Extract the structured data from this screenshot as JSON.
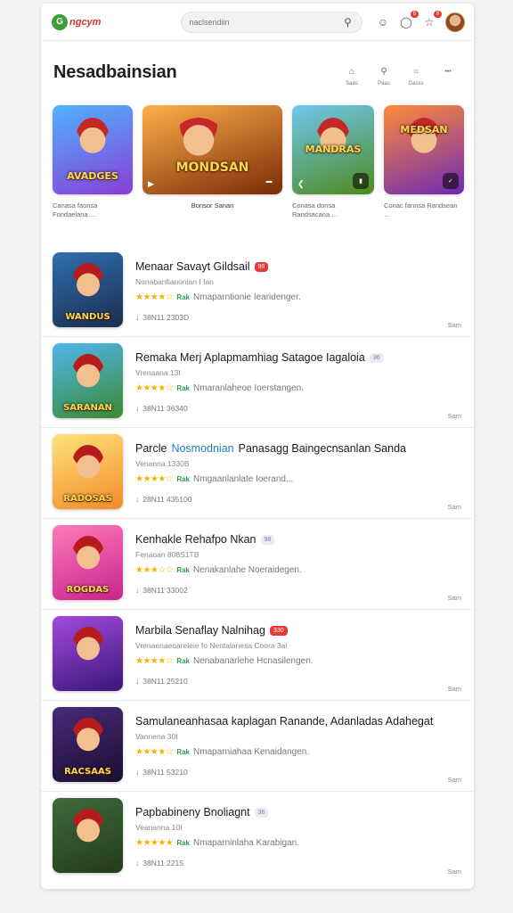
{
  "topbar": {
    "logo_mark": "G",
    "logo_text": "ngcym",
    "search_placeholder": "naclsendiin",
    "badge_1": "8",
    "badge_2": "8"
  },
  "header": {
    "title": "Nesadbainsian",
    "actions": [
      "Saas",
      "Paas",
      "Gasss"
    ],
    "more_label": "•••"
  },
  "featured": [
    {
      "name": "AVADGES",
      "caption": "Canasa faonsa Fondaelana  …",
      "colors": [
        "#4fb3ff",
        "#8a3dd6"
      ]
    },
    {
      "name": "MONDSAN",
      "caption": "Bonsor Sanan",
      "colors": [
        "#ffb04a",
        "#7a2a06"
      ]
    },
    {
      "name": "MANDRAS",
      "caption": "Conasa donsa Randsacana …",
      "colors": [
        "#6fc7ef",
        "#4f8a1f"
      ]
    },
    {
      "name": "MEDSAN",
      "caption": "Conac fannsa Randsean  …",
      "colors": [
        "#ff8a3a",
        "#6d2ab3"
      ]
    }
  ],
  "apps": [
    {
      "title": "Menaar Savayt Gildsail",
      "highlight": "",
      "tag": "99",
      "tag_style": "red",
      "sub": "Nonabanfianonian I Ian",
      "rating_tag": "Rak",
      "rating_text": "Nmaparntionie Iearidenger.",
      "meta": "38N11 2303D",
      "action": "Sam",
      "thumb_name": "WANDUS",
      "colors": [
        "#2f6fb0",
        "#1b2d4e"
      ],
      "stars": 4
    },
    {
      "title": "Remaka Merj Aplapmamhiag Satagoe Iagaloia",
      "highlight": "",
      "tag": "36",
      "tag_style": "soft",
      "sub": "Vrenaana 13I",
      "rating_tag": "Rak",
      "rating_text": "Nmaranlaheoe Ioerstangen.",
      "meta": "38N11 36340",
      "action": "Sam",
      "thumb_name": "SARANAN",
      "colors": [
        "#4fb6ef",
        "#3d8a2f"
      ],
      "stars": 4
    },
    {
      "title": "Parcle ",
      "highlight": "Nosmodnian",
      "title_rest": " Panasagg Baingecnsanlan Sanda",
      "tag": "",
      "tag_style": "",
      "sub": "Venanna 1330B",
      "rating_tag": "Rak",
      "rating_text": "Nmgaanlanlate Ioerand...",
      "meta": "28N11 435100",
      "action": "Sam",
      "thumb_name": "RADOSAS",
      "colors": [
        "#ffe27a",
        "#f28b2a"
      ],
      "stars": 4
    },
    {
      "title": "Kenhakle Rehafpo Nkan",
      "highlight": "",
      "tag": "98",
      "tag_style": "soft",
      "sub": "Fenaoan 808S1TB",
      "rating_tag": "Rak",
      "rating_text": "Nenakanlahe Noeraidegen.",
      "meta": "38N11 33002",
      "action": "Sam",
      "thumb_name": "ROGDAS",
      "colors": [
        "#ff7ab8",
        "#c8248f"
      ],
      "stars": 3
    },
    {
      "title": "Marbila Senaflay Nalnihag",
      "highlight": "",
      "tag": "330",
      "tag_style": "red",
      "sub": "Vrenaenaeoareleie fo Nentalanesa Coora 3al",
      "rating_tag": "Rak",
      "rating_text": "Nenabanarlehe Hcnasilengen.",
      "meta": "38N11 25210",
      "action": "Sam",
      "thumb_name": "",
      "colors": [
        "#a24bdc",
        "#3b1679"
      ],
      "stars": 4
    },
    {
      "title": "Samulaneanhasaa kaplagan Ranande, Adanladas Adahegat",
      "highlight": "",
      "tag": "",
      "tag_style": "",
      "sub": "Vannena 30I",
      "rating_tag": "Rak",
      "rating_text": "Nmaparniahaa Kenaidangen.",
      "meta": "38N11 53210",
      "action": "Sam",
      "thumb_name": "RACSAAS",
      "colors": [
        "#4a2a7a",
        "#1a0f2e"
      ],
      "stars": 4
    },
    {
      "title": "Papbabineny Bnoliagnt",
      "highlight": "",
      "tag": "36",
      "tag_style": "soft",
      "sub": "Veananna 10I",
      "rating_tag": "Rak",
      "rating_text": "Nmaparninlaha Karabigan.",
      "meta": "38N11 2215",
      "action": "Sam",
      "thumb_name": "",
      "colors": [
        "#3f6b3a",
        "#243a1e"
      ],
      "stars": 5
    }
  ]
}
